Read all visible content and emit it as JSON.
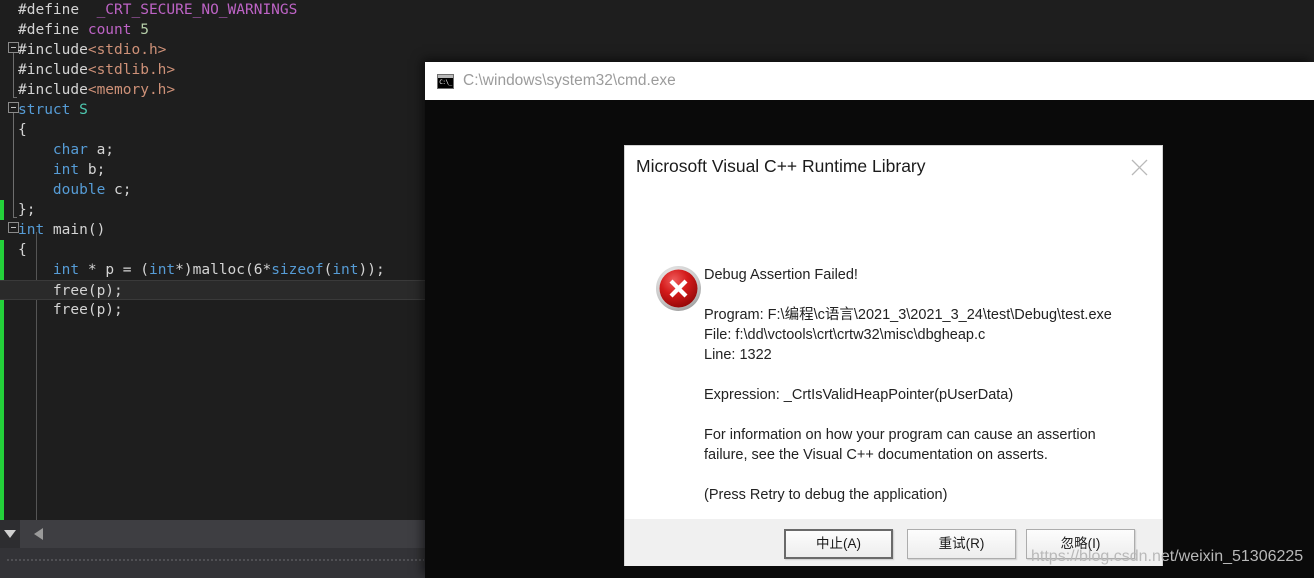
{
  "editor": {
    "name": "visual-studio-code-editor",
    "theme_background": "#1e1e1e",
    "change_bar_color": "#24d13a",
    "current_line": "free(p);",
    "lines": [
      {
        "indent": 1,
        "segments": [
          {
            "t": "#define",
            "c": "pre"
          },
          {
            "t": "  ",
            "c": "punct"
          },
          {
            "t": "_CRT_SECURE_NO_WARNINGS",
            "c": "macro"
          }
        ]
      },
      {
        "indent": 1,
        "segments": [
          {
            "t": "#define",
            "c": "pre"
          },
          {
            "t": " ",
            "c": "punct"
          },
          {
            "t": "count",
            "c": "macro"
          },
          {
            "t": " ",
            "c": "punct"
          },
          {
            "t": "5",
            "c": "num"
          }
        ]
      },
      {
        "indent": 0,
        "segments": [
          {
            "t": "#include",
            "c": "pre"
          },
          {
            "t": "<stdio.h>",
            "c": "str"
          }
        ]
      },
      {
        "indent": 1,
        "segments": [
          {
            "t": "#include",
            "c": "pre"
          },
          {
            "t": "<stdlib.h>",
            "c": "str"
          }
        ]
      },
      {
        "indent": 1,
        "segments": [
          {
            "t": "#include",
            "c": "pre"
          },
          {
            "t": "<memory.h>",
            "c": "str"
          }
        ]
      },
      {
        "indent": 0,
        "segments": [
          {
            "t": "struct",
            "c": "kw"
          },
          {
            "t": " ",
            "c": "punct"
          },
          {
            "t": "S",
            "c": "type"
          }
        ]
      },
      {
        "indent": 1,
        "segments": [
          {
            "t": "{",
            "c": "punct"
          }
        ]
      },
      {
        "indent": 1,
        "segments": [
          {
            "t": "    ",
            "c": "punct"
          },
          {
            "t": "char",
            "c": "kw"
          },
          {
            "t": " a;",
            "c": "id"
          }
        ]
      },
      {
        "indent": 1,
        "segments": [
          {
            "t": "    ",
            "c": "punct"
          },
          {
            "t": "int",
            "c": "kw"
          },
          {
            "t": " b;",
            "c": "id"
          }
        ]
      },
      {
        "indent": 1,
        "segments": [
          {
            "t": "    ",
            "c": "punct"
          },
          {
            "t": "double",
            "c": "kw"
          },
          {
            "t": " c;",
            "c": "id"
          }
        ]
      },
      {
        "indent": 1,
        "segments": [
          {
            "t": "};",
            "c": "punct"
          }
        ]
      },
      {
        "indent": 0,
        "segments": [
          {
            "t": "int",
            "c": "kw"
          },
          {
            "t": " main()",
            "c": "id"
          }
        ]
      },
      {
        "indent": 1,
        "segments": [
          {
            "t": "{",
            "c": "punct"
          }
        ]
      },
      {
        "indent": 1,
        "segments": [
          {
            "t": "    ",
            "c": "punct"
          },
          {
            "t": "int",
            "c": "kw"
          },
          {
            "t": " * p = (",
            "c": "id"
          },
          {
            "t": "int",
            "c": "kw"
          },
          {
            "t": "*)malloc(6*",
            "c": "id"
          },
          {
            "t": "sizeof",
            "c": "kw"
          },
          {
            "t": "(",
            "c": "id"
          },
          {
            "t": "int",
            "c": "kw"
          },
          {
            "t": "));",
            "c": "id"
          }
        ]
      },
      {
        "indent": 1,
        "current": true,
        "segments": [
          {
            "t": "    free(p);",
            "c": "id"
          }
        ]
      },
      {
        "indent": 1,
        "segments": [
          {
            "t": "    free(p);",
            "c": "id"
          }
        ]
      }
    ]
  },
  "console_window": {
    "title": "C:\\windows\\system32\\cmd.exe",
    "icon": "console-icon"
  },
  "dialog": {
    "title": "Microsoft Visual C++ Runtime Library",
    "close_label": "Close",
    "icon": "error-icon",
    "headline": "Debug Assertion Failed!",
    "detail_lines": [
      "Program: F:\\编程\\c语言\\2021_3\\2021_3_24\\test\\Debug\\test.exe",
      "File: f:\\dd\\vctools\\crt\\crtw32\\misc\\dbgheap.c",
      "Line: 1322"
    ],
    "expression": "Expression: _CrtIsValidHeapPointer(pUserData)",
    "info_lines": [
      "For information on how your program can cause an assertion",
      "failure, see the Visual C++ documentation on asserts."
    ],
    "hint": "(Press Retry to debug the application)",
    "buttons": {
      "abort": "中止(A)",
      "retry": "重试(R)",
      "ignore": "忽略(I)"
    }
  },
  "watermark": {
    "text": "https://blog.csdn.net/weixin_51306225"
  }
}
